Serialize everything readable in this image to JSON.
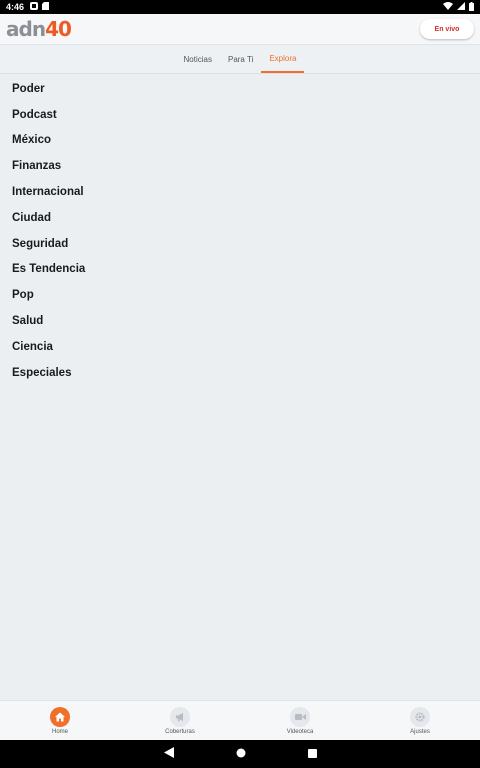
{
  "status_bar": {
    "time": "4:46"
  },
  "app": {
    "logo_text": "adn",
    "logo_number": "40",
    "live_button": "En vivo"
  },
  "tabs": [
    {
      "label": "Noticias",
      "active": false
    },
    {
      "label": "Para Ti",
      "active": false
    },
    {
      "label": "Explora",
      "active": true
    }
  ],
  "sections": [
    "Poder",
    "Podcast",
    "México",
    "Finanzas",
    "Internacional",
    "Ciudad",
    "Seguridad",
    "Es Tendencia",
    "Pop",
    "Salud",
    "Ciencia",
    "Especiales"
  ],
  "bottom_nav": [
    {
      "label": "Home",
      "icon": "home-icon",
      "active": true
    },
    {
      "label": "Coberturas",
      "icon": "megaphone-icon",
      "active": false
    },
    {
      "label": "Videoteca",
      "icon": "video-camera-icon",
      "active": false
    },
    {
      "label": "Ajustes",
      "icon": "gear-icon",
      "active": false
    }
  ],
  "colors": {
    "accent": "#f06f2b",
    "live": "#d32f2f",
    "background": "#eceff2"
  }
}
